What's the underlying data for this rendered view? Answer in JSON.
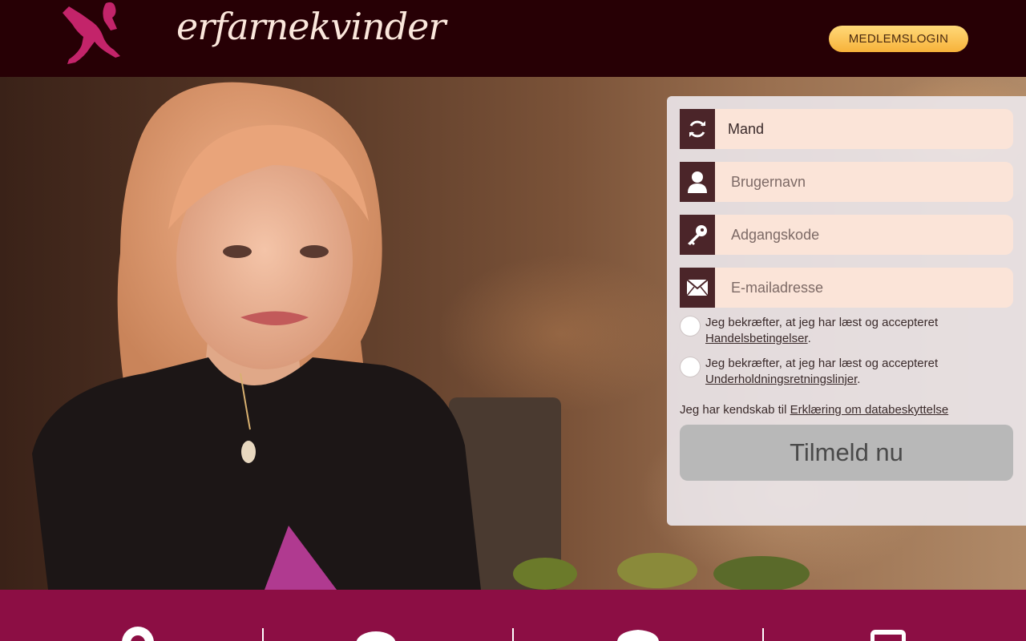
{
  "header": {
    "logo_text": "erfarnekvinder",
    "login_label": "MEDLEMSLOGIN"
  },
  "signup": {
    "gender_value": "Mand",
    "username_placeholder": "Brugernavn",
    "password_placeholder": "Adgangskode",
    "email_placeholder": "E-mailadresse",
    "terms_text": "Jeg bekræfter, at jeg har læst og accepteret",
    "terms_link": "Handelsbetingelser",
    "entertainment_text": "Jeg bekræfter, at jeg har læst og accepteret",
    "entertainment_link": "Underholdningsretningslinjer",
    "privacy_text": "Jeg har kendskab til",
    "privacy_link": "Erklæring om databeskyttelse",
    "submit_label": "Tilmeld nu"
  },
  "features": {
    "icons": [
      "location-pin-icon",
      "chat-bubble-icon",
      "badge-icon",
      "mobile-phone-icon"
    ]
  },
  "colors": {
    "header_bg": "#270005",
    "brand_magenta": "#8c0e44",
    "login_gold": "#f7b23a",
    "field_bg": "#fbe4d8",
    "icon_bg": "#4b2529"
  }
}
